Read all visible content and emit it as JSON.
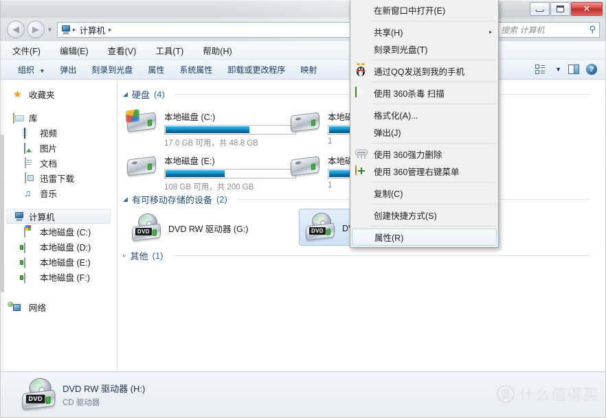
{
  "window": {
    "controls": {
      "minimize": "–",
      "maximize": "□",
      "close": "✕"
    }
  },
  "addressbar": {
    "back_glyph": "◀",
    "forward_glyph": "▶",
    "history_glyph": "▼",
    "computer_icon": "computer-icon",
    "crumb": "计算机",
    "sep": "▸",
    "dropdown_glyph": "▼",
    "refresh_glyph": "↻"
  },
  "search": {
    "placeholder": "搜索 计算机",
    "icon": "⚲"
  },
  "menubar": {
    "items": [
      {
        "label": "文件(F)"
      },
      {
        "label": "编辑(E)"
      },
      {
        "label": "查看(V)"
      },
      {
        "label": "工具(T)"
      },
      {
        "label": "帮助(H)"
      }
    ]
  },
  "toolbar": {
    "items": [
      {
        "label": "组织",
        "caret": "▼"
      },
      {
        "label": "弹出",
        "caret": ""
      },
      {
        "label": "刻录到光盘",
        "caret": ""
      },
      {
        "label": "属性",
        "caret": ""
      },
      {
        "label": "系统属性",
        "caret": ""
      },
      {
        "label": "卸载或更改程序",
        "caret": ""
      },
      {
        "label": "映射",
        "caret": ""
      }
    ],
    "view_caret": "▼",
    "help_glyph": "?"
  },
  "sidebar": {
    "items": [
      {
        "label": "收藏夹",
        "icon": "star-icon",
        "level": 0,
        "selected": false
      },
      {
        "label": "库",
        "icon": "library-icon",
        "level": 0,
        "selected": false
      },
      {
        "label": "视频",
        "icon": "video-icon",
        "level": 1,
        "selected": false
      },
      {
        "label": "图片",
        "icon": "picture-icon",
        "level": 1,
        "selected": false
      },
      {
        "label": "文档",
        "icon": "document-icon",
        "level": 1,
        "selected": false
      },
      {
        "label": "迅雷下载",
        "icon": "download-icon",
        "level": 1,
        "selected": false
      },
      {
        "label": "音乐",
        "icon": "music-icon",
        "level": 1,
        "selected": false
      },
      {
        "label": "计算机",
        "icon": "computer-icon",
        "level": 0,
        "selected": true
      },
      {
        "label": "本地磁盘 (C:)",
        "icon": "windows-drive-icon",
        "level": 1,
        "selected": false
      },
      {
        "label": "本地磁盘 (D:)",
        "icon": "hdd-icon",
        "level": 1,
        "selected": false
      },
      {
        "label": "本地磁盘 (E:)",
        "icon": "hdd-icon",
        "level": 1,
        "selected": false
      },
      {
        "label": "本地磁盘 (F:)",
        "icon": "hdd-icon",
        "level": 1,
        "selected": false
      },
      {
        "label": "网络",
        "icon": "network-icon",
        "level": 0,
        "selected": false
      }
    ]
  },
  "content": {
    "groups": [
      {
        "label": "硬盘",
        "count": "(4)",
        "expanded": true,
        "tri": "◢"
      },
      {
        "label": "有可移动存储的设备",
        "count": "(2)",
        "expanded": true,
        "tri": "◢"
      },
      {
        "label": "其他",
        "count": "(1)",
        "expanded": false,
        "tri": "▹"
      }
    ],
    "drives": [
      {
        "name": "本地磁盘 (C:)",
        "free_text": "17.0 GB 可用，共 48.8 GB",
        "used_pct": 65,
        "icon": "windows-drive-icon"
      },
      {
        "name": "本地磁盘 (E:)",
        "free_text": "108 GB 可用，共 200 GB",
        "used_pct": 46,
        "icon": "hdd-icon"
      },
      {
        "name": "本地磁盘 (D:)",
        "free_text": "1",
        "used_pct": 60,
        "icon": "hdd-icon"
      },
      {
        "name": "本地磁盘 (F:)",
        "free_text": "1",
        "used_pct": 60,
        "icon": "hdd-icon"
      }
    ],
    "removable": [
      {
        "name": "DVD RW 驱动器 (G:)",
        "selected": false
      },
      {
        "name": "DVD RW 驱动器 (H:)",
        "selected": true
      }
    ]
  },
  "details": {
    "title": "DVD RW 驱动器 (H:)",
    "subtitle": "CD 驱动器"
  },
  "watermark": {
    "mark": "值",
    "text": "什么值得买"
  },
  "context_menu": {
    "items": [
      {
        "label": "在新窗口中打开(E)",
        "icon": "",
        "submenu": false,
        "highlighted": false,
        "sep_after": true
      },
      {
        "label": "共享(H)",
        "icon": "",
        "submenu": true,
        "highlighted": false,
        "sep_after": false
      },
      {
        "label": "刻录到光盘(T)",
        "icon": "",
        "submenu": false,
        "highlighted": false,
        "sep_after": true
      },
      {
        "label": "通过QQ发送到我的手机",
        "icon": "qq-icon",
        "submenu": false,
        "highlighted": false,
        "sep_after": true
      },
      {
        "label": "使用 360杀毒 扫描",
        "icon": "shield-icon",
        "submenu": false,
        "highlighted": false,
        "sep_after": true
      },
      {
        "label": "格式化(A)...",
        "icon": "",
        "submenu": false,
        "highlighted": false,
        "sep_after": false
      },
      {
        "label": "弹出(J)",
        "icon": "",
        "submenu": false,
        "highlighted": false,
        "sep_after": true
      },
      {
        "label": "使用 360强力删除",
        "icon": "shredder-icon",
        "submenu": false,
        "highlighted": false,
        "sep_after": false
      },
      {
        "label": "使用 360管理右键菜单",
        "icon": "plus-circle-icon",
        "submenu": false,
        "highlighted": false,
        "sep_after": true
      },
      {
        "label": "复制(C)",
        "icon": "",
        "submenu": false,
        "highlighted": false,
        "sep_after": true
      },
      {
        "label": "创建快捷方式(S)",
        "icon": "",
        "submenu": false,
        "highlighted": false,
        "sep_after": true
      },
      {
        "label": "属性(R)",
        "icon": "",
        "submenu": false,
        "highlighted": true,
        "sep_after": false
      }
    ],
    "submenu_glyph": "▸"
  }
}
